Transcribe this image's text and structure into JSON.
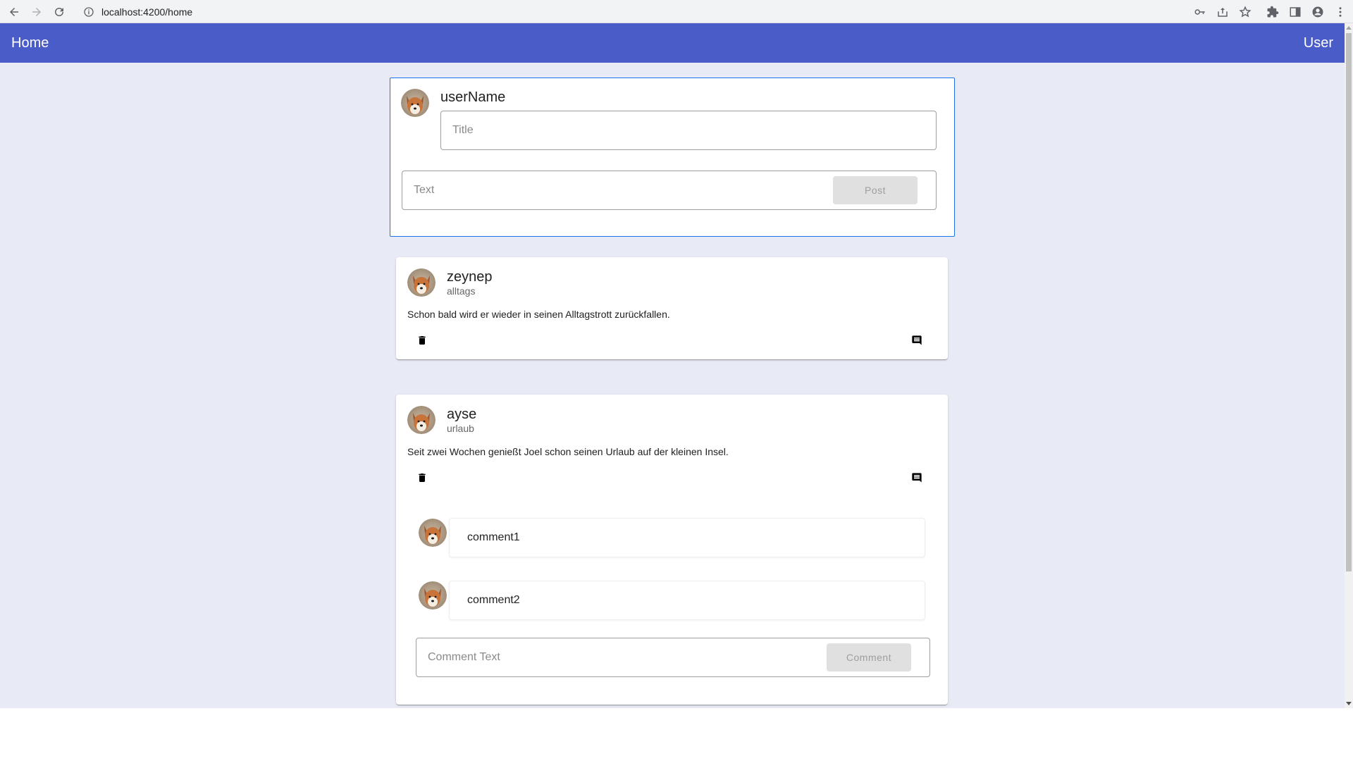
{
  "browser": {
    "url": "localhost:4200/home"
  },
  "toolbar": {
    "brand": "Home",
    "user": "User"
  },
  "new_post": {
    "user_name": "userName",
    "title_placeholder": "Title",
    "text_placeholder": "Text",
    "post_button": "Post"
  },
  "posts": [
    {
      "user": "zeynep",
      "title": "alltags",
      "text": "Schon bald wird er wieder in seinen Alltagstrott zurückfallen."
    },
    {
      "user": "ayse",
      "title": "urlaub",
      "text": "Seit zwei Wochen genießt Joel schon seinen Urlaub auf der kleinen Insel.",
      "comments": [
        {
          "text": "comment1"
        },
        {
          "text": "comment2"
        }
      ],
      "comment_placeholder": "Comment Text",
      "comment_button": "Comment"
    }
  ],
  "icons": {
    "back": "arrow-left-icon",
    "forward": "arrow-right-icon",
    "reload": "reload-icon",
    "info": "info-icon",
    "key": "key-icon",
    "share": "share-icon",
    "star": "star-icon",
    "extensions": "puzzle-icon",
    "sidepanel": "side-panel-icon",
    "profile": "profile-icon",
    "menu": "kebab-menu-icon",
    "delete": "trash-icon",
    "comment": "comment-icon"
  },
  "colors": {
    "toolbar": "#4a5cc8",
    "background": "#e8eaf6",
    "focus_border": "#1a73e8"
  }
}
